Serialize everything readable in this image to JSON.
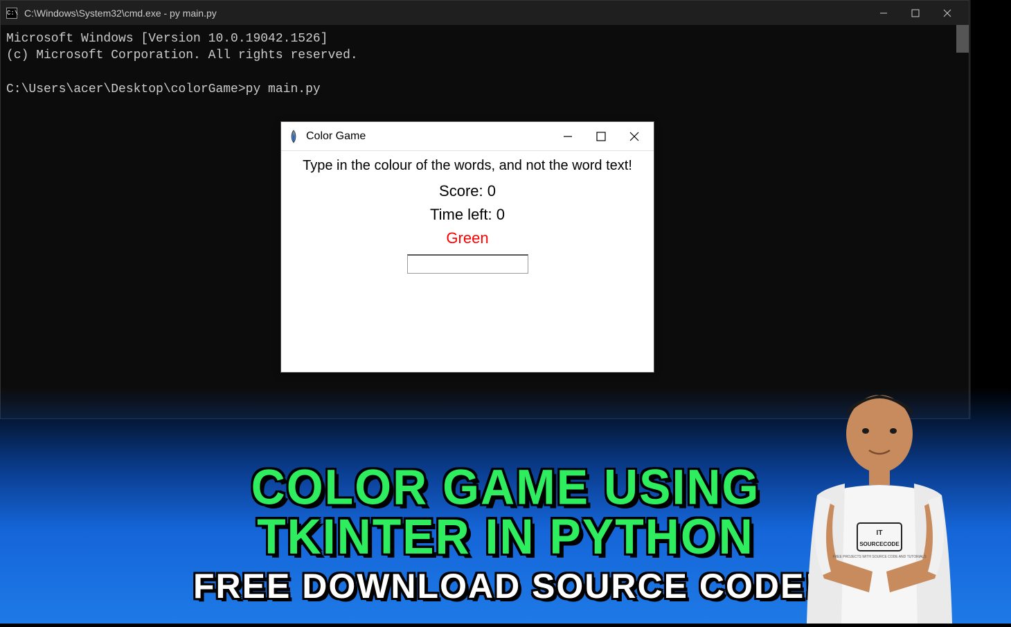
{
  "cmd": {
    "title": "C:\\Windows\\System32\\cmd.exe - py  main.py",
    "icon_label": "C:\\",
    "body_line1": "Microsoft Windows [Version 10.0.19042.1526]",
    "body_line2": "(c) Microsoft Corporation. All rights reserved.",
    "body_line3": "",
    "body_line4": "C:\\Users\\acer\\Desktop\\colorGame>py main.py",
    "minimize_icon": "minimize-icon",
    "maximize_icon": "maximize-icon",
    "close_icon": "close-icon"
  },
  "tk": {
    "title": "Color Game",
    "instruction": "Type in the colour of the words, and not the word text!",
    "score_label": "Score: 0",
    "time_label": "Time left: 0",
    "word": "Green",
    "word_color": "#ff0000",
    "input_value": "",
    "minimize_icon": "minimize-icon",
    "maximize_icon": "maximize-icon",
    "close_icon": "close-icon"
  },
  "banner": {
    "title_line1": "COLOR GAME USING",
    "title_line2": "TKINTER IN PYTHON",
    "subtitle": "FREE DOWNLOAD SOURCE CODE!"
  },
  "person": {
    "shirt_logo": "IT SOURCECODE"
  }
}
